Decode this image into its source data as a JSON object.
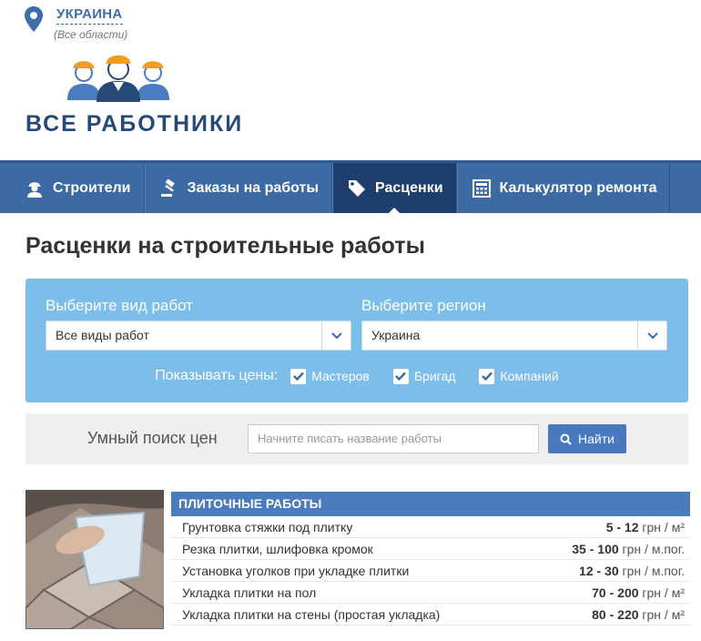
{
  "location": {
    "country": "УКРАИНА",
    "region": "(Все области)"
  },
  "logo": {
    "text": "ВСЕ  РАБОТНИКИ"
  },
  "nav": {
    "items": [
      {
        "label": "Строители",
        "icon": "worker-icon"
      },
      {
        "label": "Заказы на работы",
        "icon": "hammer-icon"
      },
      {
        "label": "Расценки",
        "icon": "price-tag-icon",
        "active": true
      },
      {
        "label": "Калькулятор ремонта",
        "icon": "calculator-icon"
      }
    ]
  },
  "page": {
    "title": "Расценки на строительные работы"
  },
  "filter": {
    "work_type_label": "Выберите вид работ",
    "work_type_value": "Все виды работ",
    "region_label": "Выберите регион",
    "region_value": "Украина",
    "show_prices_label": "Показывать цены:",
    "checkboxes": [
      {
        "label": "Мастеров",
        "checked": true
      },
      {
        "label": "Бригад",
        "checked": true
      },
      {
        "label": "Компаний",
        "checked": true
      }
    ]
  },
  "search": {
    "label": "Умный поиск цен",
    "placeholder": "Начните писать название работы",
    "button_label": "Найти"
  },
  "tile_section": {
    "header": "ПЛИТОЧНЫЕ РАБОТЫ",
    "rows": [
      {
        "name": "Грунтовка стяжки под плитку",
        "range": "5 - 12",
        "unit": "грн / м²"
      },
      {
        "name": "Резка плитки, шлифовка кромок",
        "range": "35 - 100",
        "unit": "грн / м.пог."
      },
      {
        "name": "Установка уголков при укладке плитки",
        "range": "12 - 30",
        "unit": "грн / м.пог."
      },
      {
        "name": "Укладка плитки на пол",
        "range": "70 - 200",
        "unit": "грн / м²"
      },
      {
        "name": "Укладка плитки на стены (простая укладка)",
        "range": "80 - 220",
        "unit": "грн / м²"
      }
    ]
  },
  "colors": {
    "nav_bg": "#3c6aa4",
    "nav_active": "#1e3f6e",
    "filter_bg": "#7dbde9",
    "button": "#4879be",
    "logo_text": "#27497a"
  }
}
